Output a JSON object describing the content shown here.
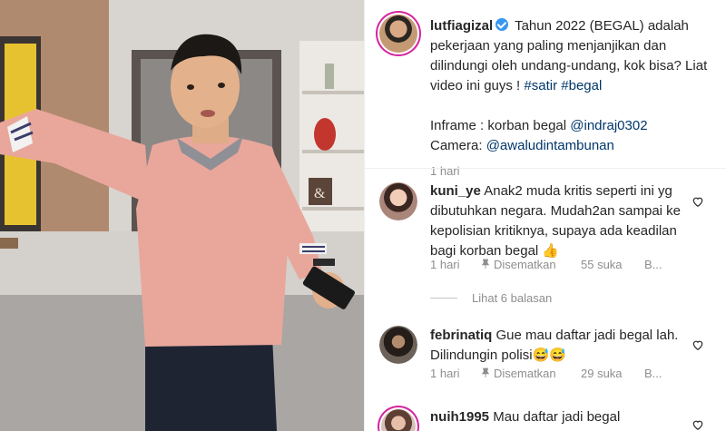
{
  "post": {
    "username": "lutfiagizal",
    "caption_text": "Tahun 2022 (BEGAL) adalah pekerjaan yang paling menjanjikan dan dilindungi oleh undang-undang, kok bisa? Liat video ini guys !",
    "hashtags": [
      "#satir",
      "#begal"
    ],
    "inframe_label": "Inframe : korban begal",
    "inframe_mention": "@indraj0302",
    "camera_label": "Camera:",
    "camera_mention": "@awaludintambunan",
    "time": "1 hari"
  },
  "comments": [
    {
      "username": "kuni_ye",
      "text": "Anak2 muda kritis seperti ini yg dibutuhkan negara. Mudah2an sampai ke kepolisian kritiknya, supaya ada keadilan bagi korban begal 👍",
      "time": "1 hari",
      "pinned": "Disematkan",
      "likes": "55 suka",
      "reply": "B..."
    },
    {
      "username": "febrinatiq",
      "text": "Gue mau daftar jadi begal lah. Dilindungin polisi😅😅",
      "time": "1 hari",
      "pinned": "Disematkan",
      "likes": "29 suka",
      "reply": "B..."
    },
    {
      "username": "nuih1995",
      "text": "Mau daftar jadi begal"
    }
  ],
  "view_replies": "Lihat 6 balasan",
  "colors": {
    "link": "#00376b",
    "verified": "#3897f0",
    "muted": "#8e8e8e"
  },
  "icons": {
    "heart": "heart-outline-icon",
    "pin": "pin-icon",
    "verified": "verified-badge-icon"
  }
}
